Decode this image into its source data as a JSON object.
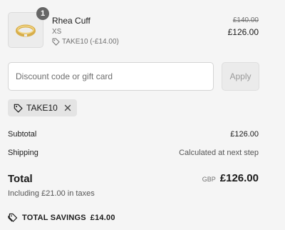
{
  "product": {
    "quantity": "1",
    "name": "Rhea Cuff",
    "variant": "XS",
    "discount_label": "TAKE10 (-£14.00)",
    "original_price": "£140.00",
    "price": "£126.00"
  },
  "discount": {
    "placeholder": "Discount code or gift card",
    "apply_label": "Apply",
    "applied_code": "TAKE10"
  },
  "summary": {
    "subtotal_label": "Subtotal",
    "subtotal_value": "£126.00",
    "shipping_label": "Shipping",
    "shipping_value": "Calculated at next step",
    "total_label": "Total",
    "currency": "GBP",
    "total_value": "£126.00",
    "taxes_note": "Including £21.00 in taxes",
    "savings_label": "TOTAL SAVINGS",
    "savings_value": "£14.00"
  },
  "colors": {
    "background": "#f5f5f5",
    "badge": "#666666",
    "tag_background": "#e4e4e4",
    "apply_button": "#ebebeb"
  },
  "icons": {
    "product_discount": "tag-icon",
    "applied_code": "tag-icon",
    "remove": "close-icon",
    "savings": "tag-icon"
  }
}
